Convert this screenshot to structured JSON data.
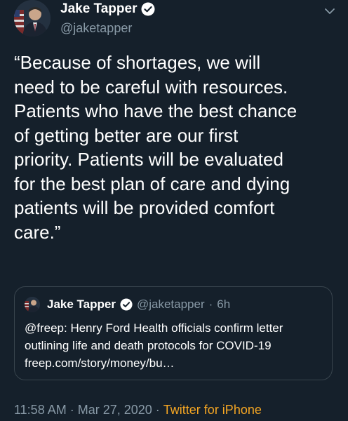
{
  "author": {
    "display_name": "Jake Tapper",
    "handle": "@jaketapper",
    "verified_icon": "verified-badge-icon"
  },
  "tweet": {
    "text": "“Because of shortages, we will\nneed to be careful with resources.\nPatients who have the best chance\nof getting better are our first\npriority. Patients will be evaluated\nfor the best plan of care and dying\npatients will be provided comfort\ncare.”"
  },
  "quoted_tweet": {
    "display_name": "Jake Tapper",
    "handle": "@jaketapper",
    "separator": "·",
    "time": "6h",
    "text": "@freep: Henry Ford Health officials confirm letter\noutlining life and death protocols for COVID-19\nfreep.com/story/money/bu…"
  },
  "meta": {
    "time": "11:58 AM",
    "sep1": "·",
    "date": "Mar 27, 2020",
    "sep2": "·",
    "source": "Twitter for iPhone"
  },
  "colors": {
    "background": "#15202b",
    "secondary_text": "#8899a6",
    "source_link": "#f5a623",
    "verified_blue": "#ffffff"
  }
}
